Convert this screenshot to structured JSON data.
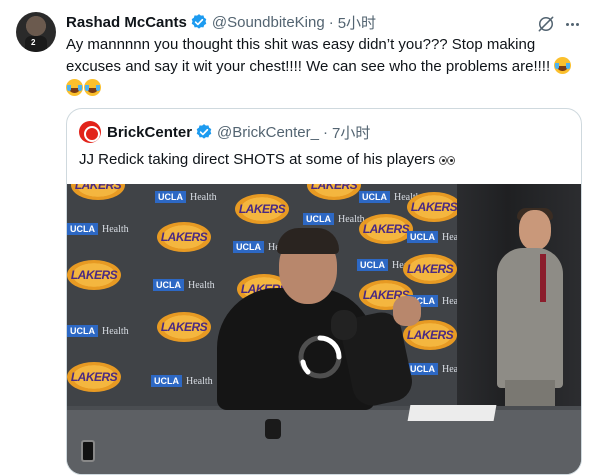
{
  "tweet": {
    "author_name": "Rashad McCants",
    "author_handle": "@SoundbiteKing",
    "separator": "·",
    "timestamp": "5小时",
    "text": "Ay mannnnn you thought this shit was easy didn’t you??? Stop making excuses and say it wit your chest!!!! We can see who the problems are!!!!",
    "emoji_name": "face-with-tears-of-joy",
    "avatar_jersey_number": "2",
    "verified_color": "#1d9bf0"
  },
  "quote": {
    "author_name": "BrickCenter",
    "author_handle": "@BrickCenter_",
    "separator": "·",
    "timestamp": "7小时",
    "text": "JJ Redick taking direct SHOTS at some of his players",
    "emoji_name": "eyes"
  },
  "video": {
    "backdrop_ucla_prefix": "UCLA",
    "backdrop_ucla_word": "Health",
    "backdrop_team_word": "LAKERS",
    "loading": true
  },
  "icons": {
    "grok": "grok-icon",
    "more": "more-icon"
  }
}
